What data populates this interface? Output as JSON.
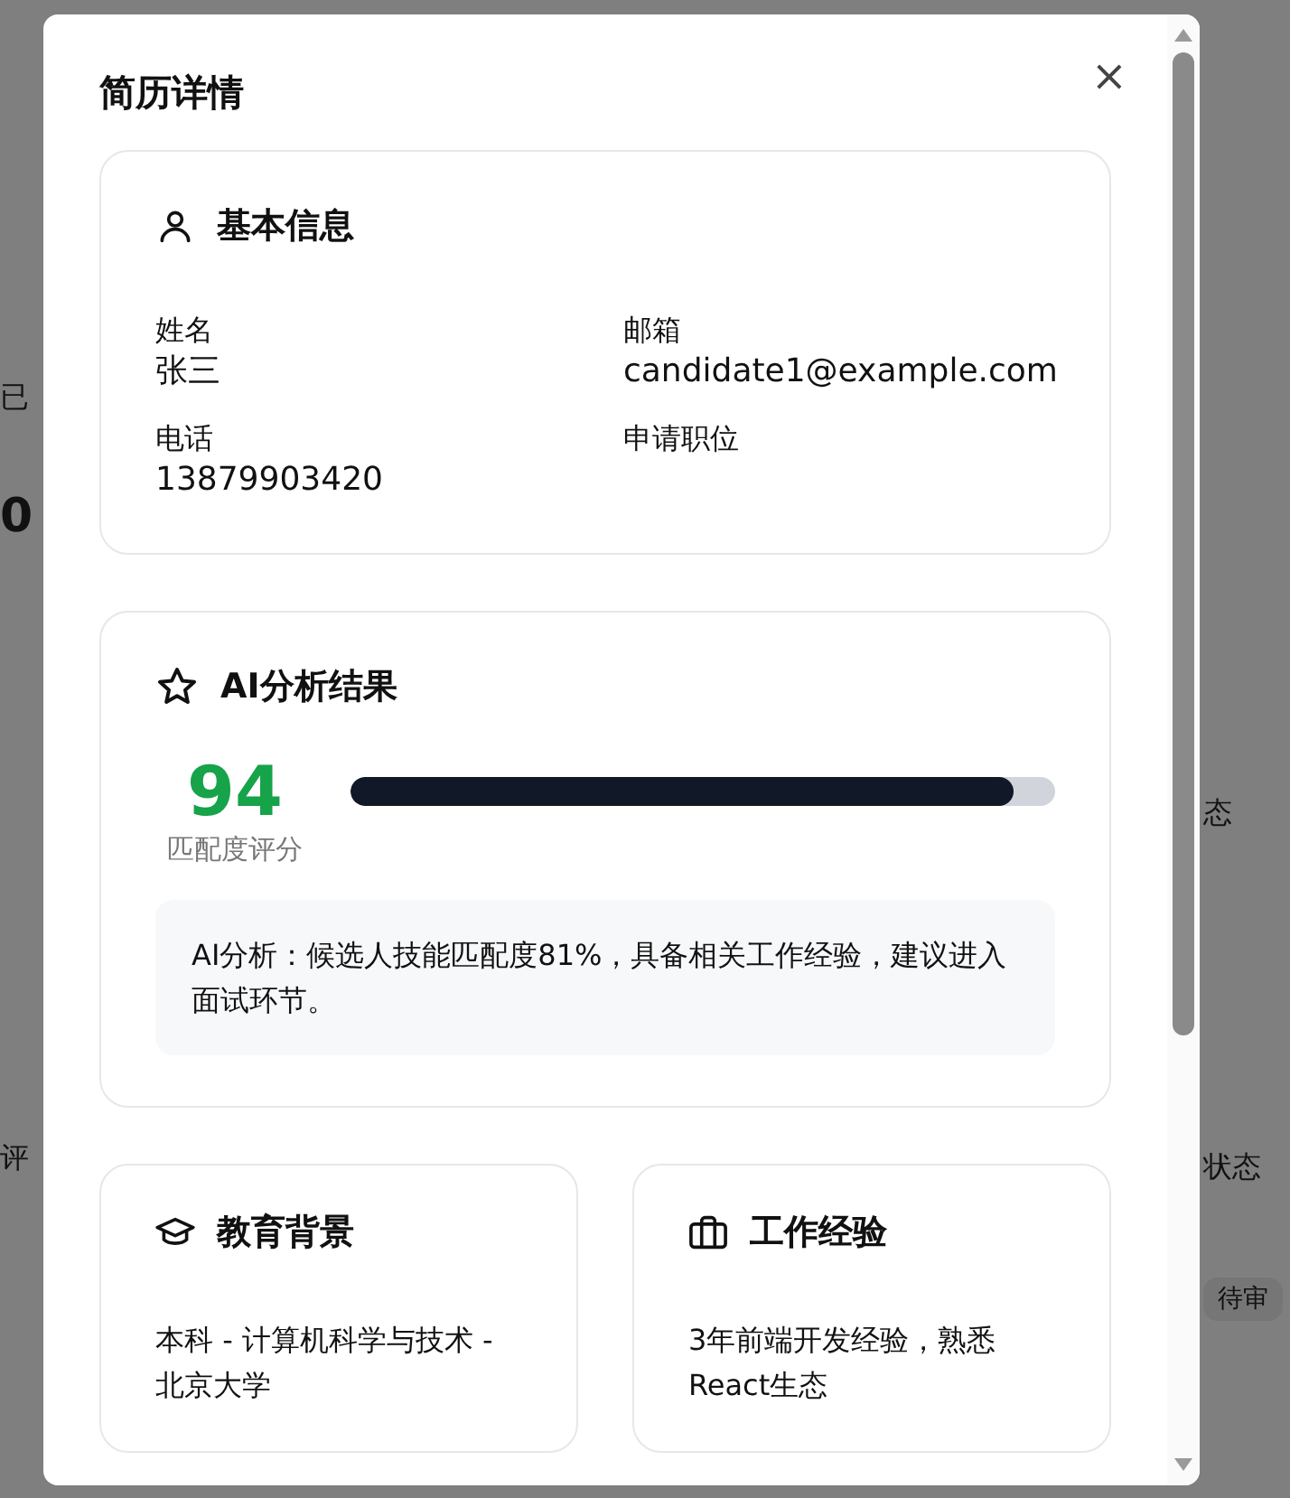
{
  "background": {
    "left_fragments": [
      {
        "text": "已",
        "kind": "label"
      },
      {
        "text": "0",
        "kind": "number"
      },
      {
        "text": "评",
        "kind": "label"
      }
    ],
    "right_fragments": [
      {
        "text": "态",
        "kind": "label"
      },
      {
        "text": "状态",
        "kind": "label"
      },
      {
        "text": "待审",
        "kind": "badge"
      }
    ]
  },
  "dialog": {
    "title": "简历详情",
    "close": "×",
    "basic_info": {
      "heading": "基本信息",
      "fields": [
        {
          "label": "姓名",
          "value": "张三"
        },
        {
          "label": "邮箱",
          "value": "candidate1@example.com"
        },
        {
          "label": "电话",
          "value": "13879903420"
        },
        {
          "label": "申请职位"
        }
      ]
    },
    "ai_analysis": {
      "heading": "AI分析结果",
      "score": "94",
      "score_label": "匹配度评分",
      "level": 0.94,
      "summary": "AI分析：候选人技能匹配度81%，具备相关工作经验，建议进入面试环节。"
    },
    "education": {
      "heading": "教育背景",
      "text": "本科 - 计算机科学与技术 - 北京大学"
    },
    "experience": {
      "heading": "工作经验",
      "text": "3年前端开发经验，熟悉React生态"
    }
  }
}
